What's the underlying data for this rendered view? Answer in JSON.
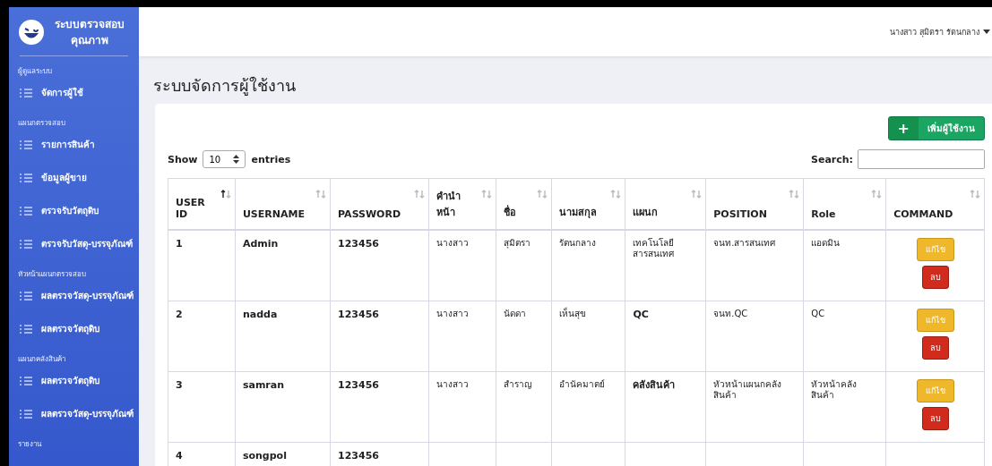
{
  "sidebar": {
    "brand": "ระบบตรวจสอบคุณภาพ",
    "sections": [
      {
        "heading": "ผู้ดูแลระบบ",
        "items": [
          {
            "label": "จัดการผู้ใช้"
          }
        ]
      },
      {
        "heading": "แผนกตรวจสอบ",
        "items": [
          {
            "label": "รายการสินค้า"
          },
          {
            "label": "ข้อมูลผู้ขาย"
          },
          {
            "label": "ตรวจรับวัตถุดิบ"
          },
          {
            "label": "ตรวจรับวัสดุ-บรรจุภัณฑ์"
          }
        ]
      },
      {
        "heading": "หัวหน้าแผนกตรวจสอบ",
        "items": [
          {
            "label": "ผลตรวจวัสดุ-บรรจุภัณฑ์"
          },
          {
            "label": "ผลตรวจวัตถุดิบ"
          }
        ]
      },
      {
        "heading": "แผนกคลังสินค้า",
        "items": [
          {
            "label": "ผลตรวจวัตถุดิบ"
          },
          {
            "label": "ผลตรวจวัสดุ-บรรจุภัณฑ์"
          }
        ]
      },
      {
        "heading": "รายงาน"
      }
    ]
  },
  "topbar": {
    "user": "นางสาว สุมิตรา รัตนกลาง"
  },
  "page_title": "ระบบจัดการผู้ใช้งาน",
  "add_button": {
    "icon": "+",
    "label": "เพิ่มผู้ใช้งาน"
  },
  "length": {
    "before": "Show",
    "value": "10",
    "after": "entries"
  },
  "search": {
    "label": "Search:"
  },
  "table": {
    "columns": [
      {
        "label": "USER ID",
        "sorted": true
      },
      {
        "label": "USERNAME",
        "sorted": false
      },
      {
        "label": "PASSWORD",
        "sorted": false
      },
      {
        "label": "คำนำหน้า",
        "sorted": false
      },
      {
        "label": "ชื่อ",
        "sorted": false
      },
      {
        "label": "นามสกุล",
        "sorted": false
      },
      {
        "label": "แผนก",
        "sorted": false
      },
      {
        "label": "POSITION",
        "sorted": false
      },
      {
        "label": "Role",
        "sorted": false
      },
      {
        "label": "COMMAND",
        "sorted": false
      }
    ],
    "rows": [
      {
        "cells": [
          "1",
          "Admin",
          "123456",
          "นางสาว",
          "สุมิตรา",
          "รัตนกลาง",
          "เทคโนโลยีสารสนเทศ",
          "จนท.สารสนเทศ",
          "แอดมิน"
        ],
        "edit": "แก้ไข",
        "delete": "ลบ"
      },
      {
        "cells": [
          "2",
          "nadda",
          "123456",
          "นางสาว",
          "นัดดา",
          "เห็นสุข",
          "QC",
          "จนท.QC",
          "QC"
        ],
        "edit": "แก้ไข",
        "delete": "ลบ"
      },
      {
        "cells": [
          "3",
          "samran",
          "123456",
          "นางสาว",
          "สำราญ",
          "อำนัคมาตย์",
          "คลังสินค้า",
          "หัวหน้าแผนกคลังสินค้า",
          "หัวหน้าคลังสินค้า"
        ],
        "edit": "แก้ไข",
        "delete": "ลบ"
      },
      {
        "cells": [
          "4",
          "songpol",
          "123456"
        ]
      }
    ]
  }
}
